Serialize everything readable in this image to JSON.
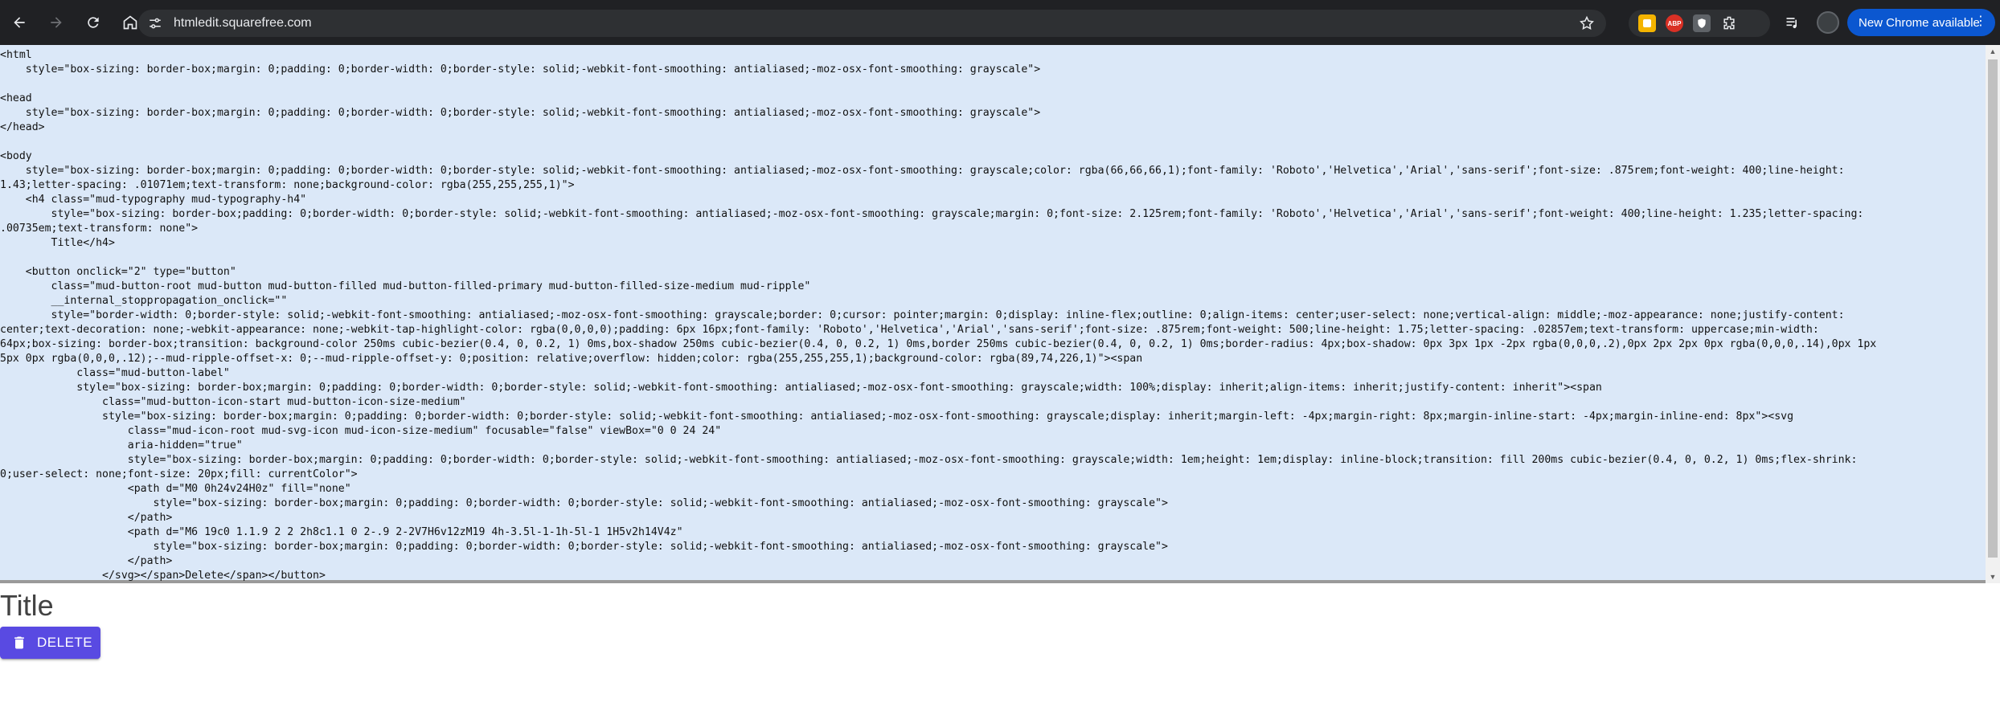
{
  "browser": {
    "url": "htmledit.squarefree.com",
    "update_label": "New Chrome available",
    "extensions": [
      "yellow-extension-icon",
      "adblock-plus-icon",
      "shield-extension-icon",
      "extensions-puzzle-icon"
    ],
    "abp_text": "ABP"
  },
  "editor": {
    "lines": [
      "<html",
      "    style=\"box-sizing: border-box;margin: 0;padding: 0;border-width: 0;border-style: solid;-webkit-font-smoothing: antialiased;-moz-osx-font-smoothing: grayscale\">",
      "",
      "<head",
      "    style=\"box-sizing: border-box;margin: 0;padding: 0;border-width: 0;border-style: solid;-webkit-font-smoothing: antialiased;-moz-osx-font-smoothing: grayscale\">",
      "</head>",
      "",
      "<body",
      "    style=\"box-sizing: border-box;margin: 0;padding: 0;border-width: 0;border-style: solid;-webkit-font-smoothing: antialiased;-moz-osx-font-smoothing: grayscale;color: rgba(66,66,66,1);font-family: 'Roboto','Helvetica','Arial','sans-serif';font-size: .875rem;font-weight: 400;line-height:",
      "1.43;letter-spacing: .01071em;text-transform: none;background-color: rgba(255,255,255,1)\">",
      "    <h4 class=\"mud-typography mud-typography-h4\"",
      "        style=\"box-sizing: border-box;padding: 0;border-width: 0;border-style: solid;-webkit-font-smoothing: antialiased;-moz-osx-font-smoothing: grayscale;margin: 0;font-size: 2.125rem;font-family: 'Roboto','Helvetica','Arial','sans-serif';font-weight: 400;line-height: 1.235;letter-spacing:",
      ".00735em;text-transform: none\">",
      "        Title</h4>",
      "",
      "    <button onclick=\"2\" type=\"button\"",
      "        class=\"mud-button-root mud-button mud-button-filled mud-button-filled-primary mud-button-filled-size-medium mud-ripple\"",
      "        __internal_stoppropagation_onclick=\"\"",
      "        style=\"border-width: 0;border-style: solid;-webkit-font-smoothing: antialiased;-moz-osx-font-smoothing: grayscale;border: 0;cursor: pointer;margin: 0;display: inline-flex;outline: 0;align-items: center;user-select: none;vertical-align: middle;-moz-appearance: none;justify-content:",
      "center;text-decoration: none;-webkit-appearance: none;-webkit-tap-highlight-color: rgba(0,0,0,0);padding: 6px 16px;font-family: 'Roboto','Helvetica','Arial','sans-serif';font-size: .875rem;font-weight: 500;line-height: 1.75;letter-spacing: .02857em;text-transform: uppercase;min-width:",
      "64px;box-sizing: border-box;transition: background-color 250ms cubic-bezier(0.4, 0, 0.2, 1) 0ms,box-shadow 250ms cubic-bezier(0.4, 0, 0.2, 1) 0ms,border 250ms cubic-bezier(0.4, 0, 0.2, 1) 0ms;border-radius: 4px;box-shadow: 0px 3px 1px -2px rgba(0,0,0,.2),0px 2px 2px 0px rgba(0,0,0,.14),0px 1px",
      "5px 0px rgba(0,0,0,.12);--mud-ripple-offset-x: 0;--mud-ripple-offset-y: 0;position: relative;overflow: hidden;color: rgba(255,255,255,1);background-color: rgba(89,74,226,1)\"><span",
      "            class=\"mud-button-label\"",
      "            style=\"box-sizing: border-box;margin: 0;padding: 0;border-width: 0;border-style: solid;-webkit-font-smoothing: antialiased;-moz-osx-font-smoothing: grayscale;width: 100%;display: inherit;align-items: inherit;justify-content: inherit\"><span",
      "                class=\"mud-button-icon-start mud-button-icon-size-medium\"",
      "                style=\"box-sizing: border-box;margin: 0;padding: 0;border-width: 0;border-style: solid;-webkit-font-smoothing: antialiased;-moz-osx-font-smoothing: grayscale;display: inherit;margin-left: -4px;margin-right: 8px;margin-inline-start: -4px;margin-inline-end: 8px\"><svg",
      "                    class=\"mud-icon-root mud-svg-icon mud-icon-size-medium\" focusable=\"false\" viewBox=\"0 0 24 24\"",
      "                    aria-hidden=\"true\"",
      "                    style=\"box-sizing: border-box;margin: 0;padding: 0;border-width: 0;border-style: solid;-webkit-font-smoothing: antialiased;-moz-osx-font-smoothing: grayscale;width: 1em;height: 1em;display: inline-block;transition: fill 200ms cubic-bezier(0.4, 0, 0.2, 1) 0ms;flex-shrink:",
      "0;user-select: none;font-size: 20px;fill: currentColor\">",
      "                    <path d=\"M0 0h24v24H0z\" fill=\"none\"",
      "                        style=\"box-sizing: border-box;margin: 0;padding: 0;border-width: 0;border-style: solid;-webkit-font-smoothing: antialiased;-moz-osx-font-smoothing: grayscale\">",
      "                    </path>",
      "                    <path d=\"M6 19c0 1.1.9 2 2 2h8c1.1 0 2-.9 2-2V7H6v12zM19 4h-3.5l-1-1h-5l-1 1H5v2h14V4z\"",
      "                        style=\"box-sizing: border-box;margin: 0;padding: 0;border-width: 0;border-style: solid;-webkit-font-smoothing: antialiased;-moz-osx-font-smoothing: grayscale\">",
      "                    </path>",
      "                </svg></span>Delete</span></button>"
    ]
  },
  "preview": {
    "title": "Title",
    "button_label": "DELETE",
    "button_color": "#594ae2"
  }
}
